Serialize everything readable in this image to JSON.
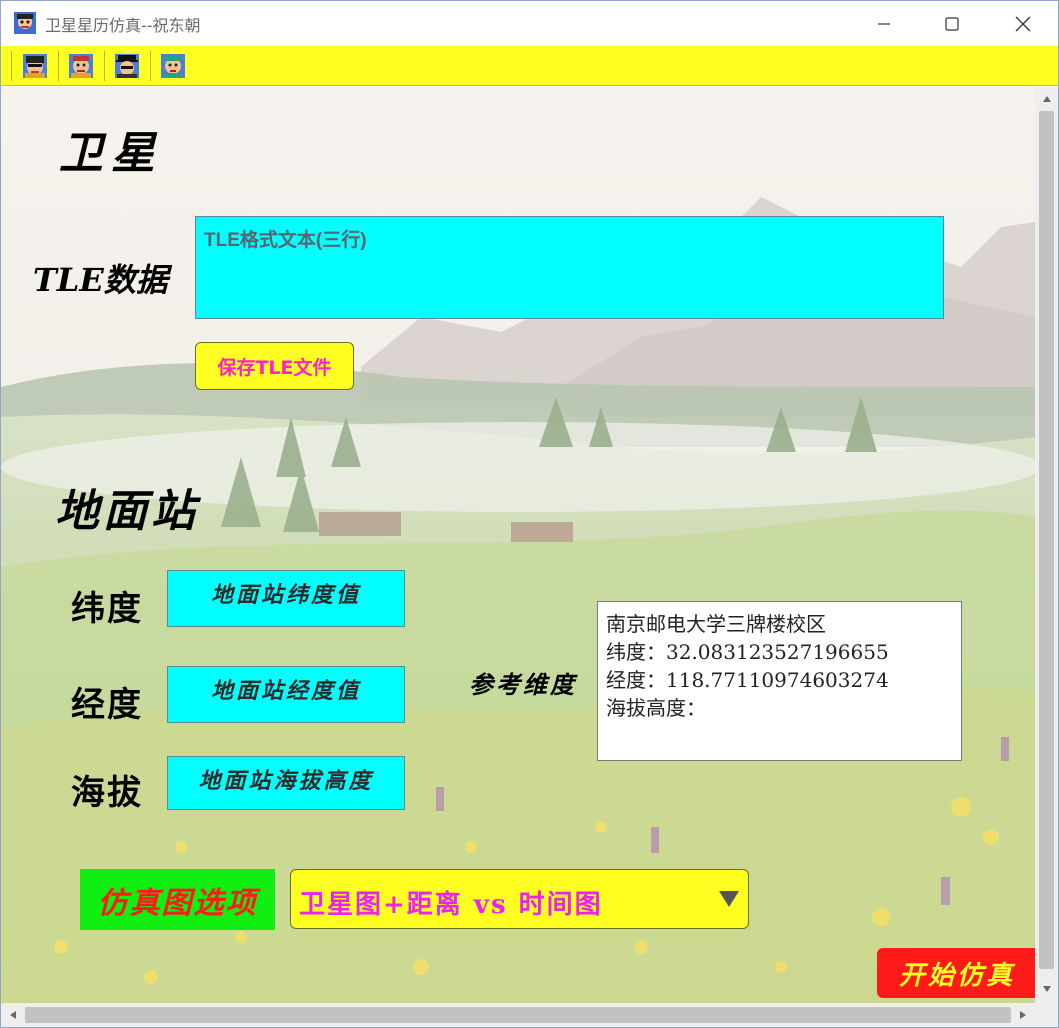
{
  "window": {
    "title": "卫星星历仿真--祝东朝",
    "icons": [
      "app-icon",
      "minimize-icon",
      "maximize-icon",
      "close-icon"
    ]
  },
  "toolbar": {
    "buttons": [
      {
        "icon": "cartoon-avatar-icon-1"
      },
      {
        "icon": "cartoon-avatar-icon-2"
      },
      {
        "icon": "cartoon-avatar-icon-3"
      },
      {
        "icon": "cartoon-avatar-icon-4"
      }
    ],
    "background_color": "#ffff22"
  },
  "satellite": {
    "heading": "卫星",
    "tle_label": "TLE数据",
    "tle_placeholder": "TLE格式文本(三行)",
    "save_button": "保存TLE文件"
  },
  "ground_station": {
    "heading": "地面站",
    "lat_label": "纬度",
    "lat_placeholder": "地面站纬度值",
    "lon_label": "经度",
    "lon_placeholder": "地面站经度值",
    "alt_label": "海拔",
    "alt_placeholder": "地面站海拔高度",
    "reference_label": "参考维度",
    "reference": {
      "line1": "南京邮电大学三牌楼校区",
      "line2": "纬度：32.083123527196655",
      "line3": "经度：118.77110974603274",
      "line4": "海拔高度："
    }
  },
  "simulation": {
    "options_label": "仿真图选项",
    "selected_option": "卫星图+距离 vs 时间图",
    "start_button": "开始仿真"
  },
  "colors": {
    "input_bg": "#00ffff",
    "accent_yellow": "#ffff22",
    "option_label_bg": "#11ee11",
    "start_button_bg": "#ff1a1a"
  }
}
